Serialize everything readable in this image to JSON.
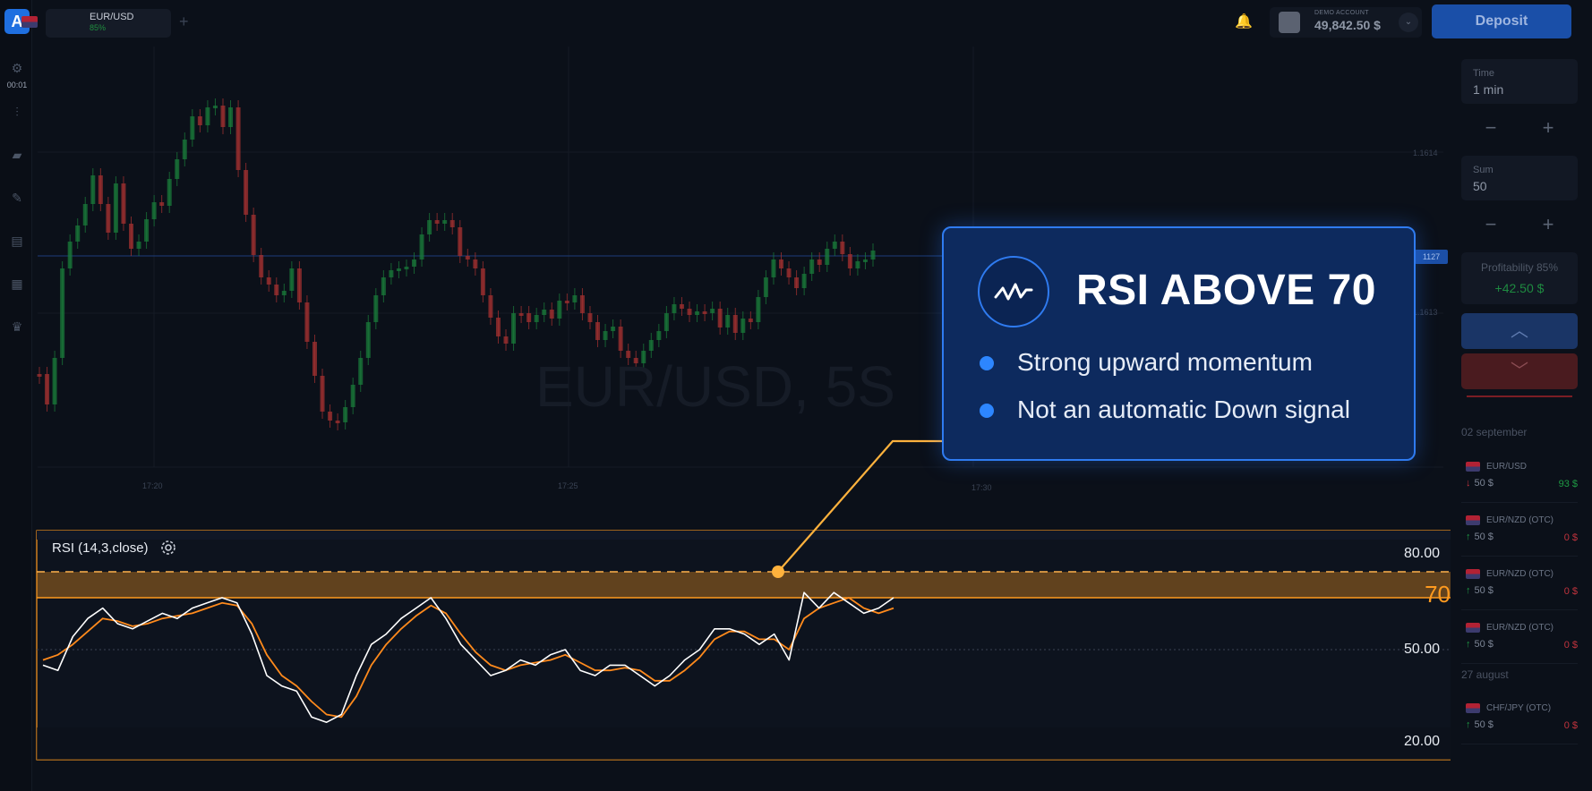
{
  "topbar": {
    "asset_name": "EUR/USD",
    "asset_payout": "85%",
    "account_label": "DEMO ACCOUNT",
    "balance": "49,842.50 $",
    "deposit_label": "Deposit"
  },
  "sidebar": {
    "timer": "00:01"
  },
  "trade_panel": {
    "time_label": "Time",
    "time_value": "1 min",
    "sum_label": "Sum",
    "sum_value": "50",
    "profit_label": "Profitability 85%",
    "profit_value": "+42.50 $"
  },
  "history": {
    "date1": "02 september",
    "date2": "27 august",
    "trades": [
      {
        "pair": "EUR/USD",
        "dir": "↓",
        "amount": "50 $",
        "result": "93 $",
        "result_color": "#1e9a44",
        "dir_color": "#c0333d"
      },
      {
        "pair": "EUR/NZD (OTC)",
        "dir": "↑",
        "amount": "50 $",
        "result": "0 $",
        "result_color": "#c0333d",
        "dir_color": "#1e9a44"
      },
      {
        "pair": "EUR/NZD (OTC)",
        "dir": "↑",
        "amount": "50 $",
        "result": "0 $",
        "result_color": "#c0333d",
        "dir_color": "#1e9a44"
      },
      {
        "pair": "EUR/NZD (OTC)",
        "dir": "↑",
        "amount": "50 $",
        "result": "0 $",
        "result_color": "#c0333d",
        "dir_color": "#1e9a44"
      },
      {
        "pair": "CHF/JPY (OTC)",
        "dir": "↑",
        "amount": "50 $",
        "result": "0 $",
        "result_color": "#c0333d",
        "dir_color": "#1e9a44"
      }
    ]
  },
  "chart": {
    "watermark": "EUR/USD, 5S",
    "time_labels": [
      "17:20",
      "17:25",
      "17:30"
    ],
    "price_labels": [
      "1.1614",
      "1.1613"
    ],
    "price_tag": "1127",
    "rsi_label": "RSI (14,3,close)",
    "level_80": "80.00",
    "level_50": "50.00",
    "level_20": "20.00",
    "level_70": "70"
  },
  "tooltip": {
    "title": "RSI ABOVE 70",
    "bullets": [
      "Strong upward momentum",
      "Not an automatic Down signal"
    ]
  },
  "colors": {
    "bull": "#1a7a3a",
    "bear": "#a33030",
    "rsi_line": "#ffffff",
    "rsi_signal": "#ff8a1c",
    "overbought_band": "#ff9a1f",
    "accent": "#2f7bf0"
  },
  "chart_data": {
    "type": "line",
    "title": "RSI (14,3,close)",
    "ylim": [
      0,
      100
    ],
    "levels": [
      80,
      70,
      50,
      20
    ],
    "series": [
      {
        "values": [
          44,
          42,
          55,
          62,
          66,
          60,
          58,
          61,
          64,
          62,
          66,
          68,
          70,
          68,
          56,
          40,
          36,
          34,
          24,
          22,
          25,
          40,
          52,
          56,
          62,
          66,
          70,
          62,
          52,
          46,
          40,
          42,
          46,
          44,
          48,
          50,
          42,
          40,
          44,
          44,
          40,
          36,
          40,
          46,
          50,
          58,
          58,
          56,
          52,
          56,
          46,
          72,
          66,
          72,
          68,
          64,
          66,
          70
        ]
      },
      {
        "values": [
          46,
          48,
          52,
          57,
          62,
          61,
          59,
          60,
          62,
          63,
          64,
          66,
          68,
          67,
          60,
          48,
          40,
          36,
          30,
          25,
          24,
          32,
          44,
          52,
          58,
          63,
          67,
          64,
          56,
          49,
          44,
          42,
          44,
          45,
          46,
          48,
          45,
          42,
          42,
          43,
          42,
          38,
          38,
          42,
          47,
          54,
          57,
          57,
          54,
          54,
          50,
          62,
          66,
          68,
          70,
          66,
          64,
          66
        ]
      }
    ]
  }
}
